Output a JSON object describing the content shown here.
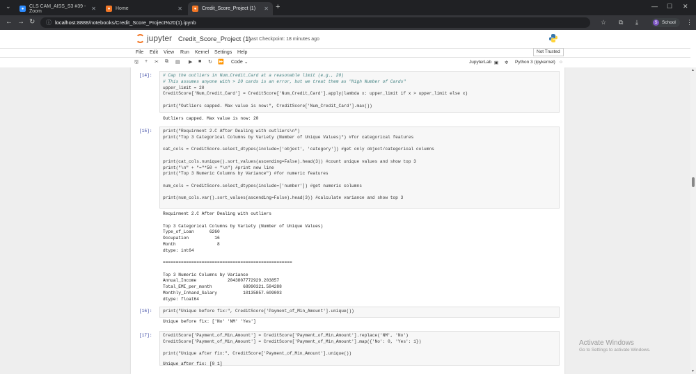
{
  "browser": {
    "tabs": [
      {
        "title": "CLS CAM_AISS_S3 #39 - Zoom",
        "favicon_color": "#2d8cff"
      },
      {
        "title": "Home",
        "favicon_color": "#f37726"
      },
      {
        "title": "Credit_Score_Project (1)",
        "favicon_color": "#f37726"
      }
    ],
    "url_host": "localhost",
    "url_path": ":8888/notebooks/Credit_Score_Project%20(1).ipynb",
    "profile_initial": "S",
    "profile_label": "School"
  },
  "jupyter": {
    "logo_text": "jupyter",
    "notebook_title": "Credit_Score_Project (1)",
    "checkpoint": "Last Checkpoint: 18 minutes ago",
    "trusted": "Not Trusted",
    "menu": [
      "File",
      "Edit",
      "View",
      "Run",
      "Kernel",
      "Settings",
      "Help"
    ],
    "cell_type": "Code",
    "lab_link": "JupyterLab",
    "kernel": "Python 3 (ipykernel)"
  },
  "cells": [
    {
      "prompt": "[14]:",
      "code": [
        "# Cap the outliers in Num_Credit_Card at a reasonable limit (e.g., 20)",
        "# This assumes anyone with > 20 cards is an error, but we treat them as \"High Number of Cards\"",
        "upper_limit = 20",
        "CreditScore['Num_Credit_Card'] = CreditScore['Num_Credit_Card'].apply(lambda x: upper_limit if x > upper_limit else x)",
        "",
        "print(\"Outliers capped. Max value is now:\", CreditScore['Num_Credit_Card'].max())"
      ],
      "output": [
        "Outliers capped. Max value is now: 20"
      ]
    },
    {
      "prompt": "[15]:",
      "code": [
        "print(\"Requirment 2.C After Dealing with outliers\\n\")",
        "print(\"Top 3 Categorical Columns by Variety (Number of Unique Values)\") #for categorical features",
        "",
        "cat_cols = CreditScore.select_dtypes(include=['object', 'category']) #get only object/categorical columns",
        "",
        "print(cat_cols.nunique().sort_values(ascending=False).head(3)) #count unique values and show top 3",
        "print(\"\\n\" + \"=\"*50 + \"\\n\") #print new line",
        "print(\"Top 3 Numeric Columns by Variance\") #for numeric features",
        "",
        "num_cols = CreditScore.select_dtypes(include=['number']) #get numeric columns",
        "",
        "print(num_cols.var().sort_values(ascending=False).head(3)) #calculate variance and show top 3"
      ],
      "output": [
        "Requirment 2.C After Dealing with outliers",
        "",
        "Top 3 Categorical Columns by Variety (Number of Unique Values)",
        "Type_of_Loan      6260",
        "Occupation          16",
        "Month                8",
        "dtype: int64",
        "",
        "==================================================",
        "",
        "Top 3 Numeric Columns by Variance",
        "Annual_Income            2043807772929.203857",
        "Total_EMI_per_month            68990321.584288",
        "Monthly_Inhand_Salary          10135857.609003",
        "dtype: float64"
      ]
    },
    {
      "prompt": "[16]:",
      "code": [
        "print(\"Unique before fix:\", CreditScore['Payment_of_Min_Amount'].unique())"
      ],
      "output": [
        "Unique before fix: ['No' 'NM' 'Yes']"
      ]
    },
    {
      "prompt": "[17]:",
      "code": [
        "CreditScore['Payment_of_Min_Amount'] = CreditScore['Payment_of_Min_Amount'].replace('NM', 'No')",
        "CreditScore['Payment_of_Min_Amount'] = CreditScore['Payment_of_Min_Amount'].map({'No': 0, 'Yes': 1})",
        "",
        "print(\"Unique after fix:\", CreditScore['Payment_of_Min_Amount'].unique())"
      ],
      "output": [
        "Unique after fix: [0 1]"
      ]
    }
  ],
  "watermark": {
    "title": "Activate Windows",
    "subtitle": "Go to Settings to activate Windows."
  }
}
